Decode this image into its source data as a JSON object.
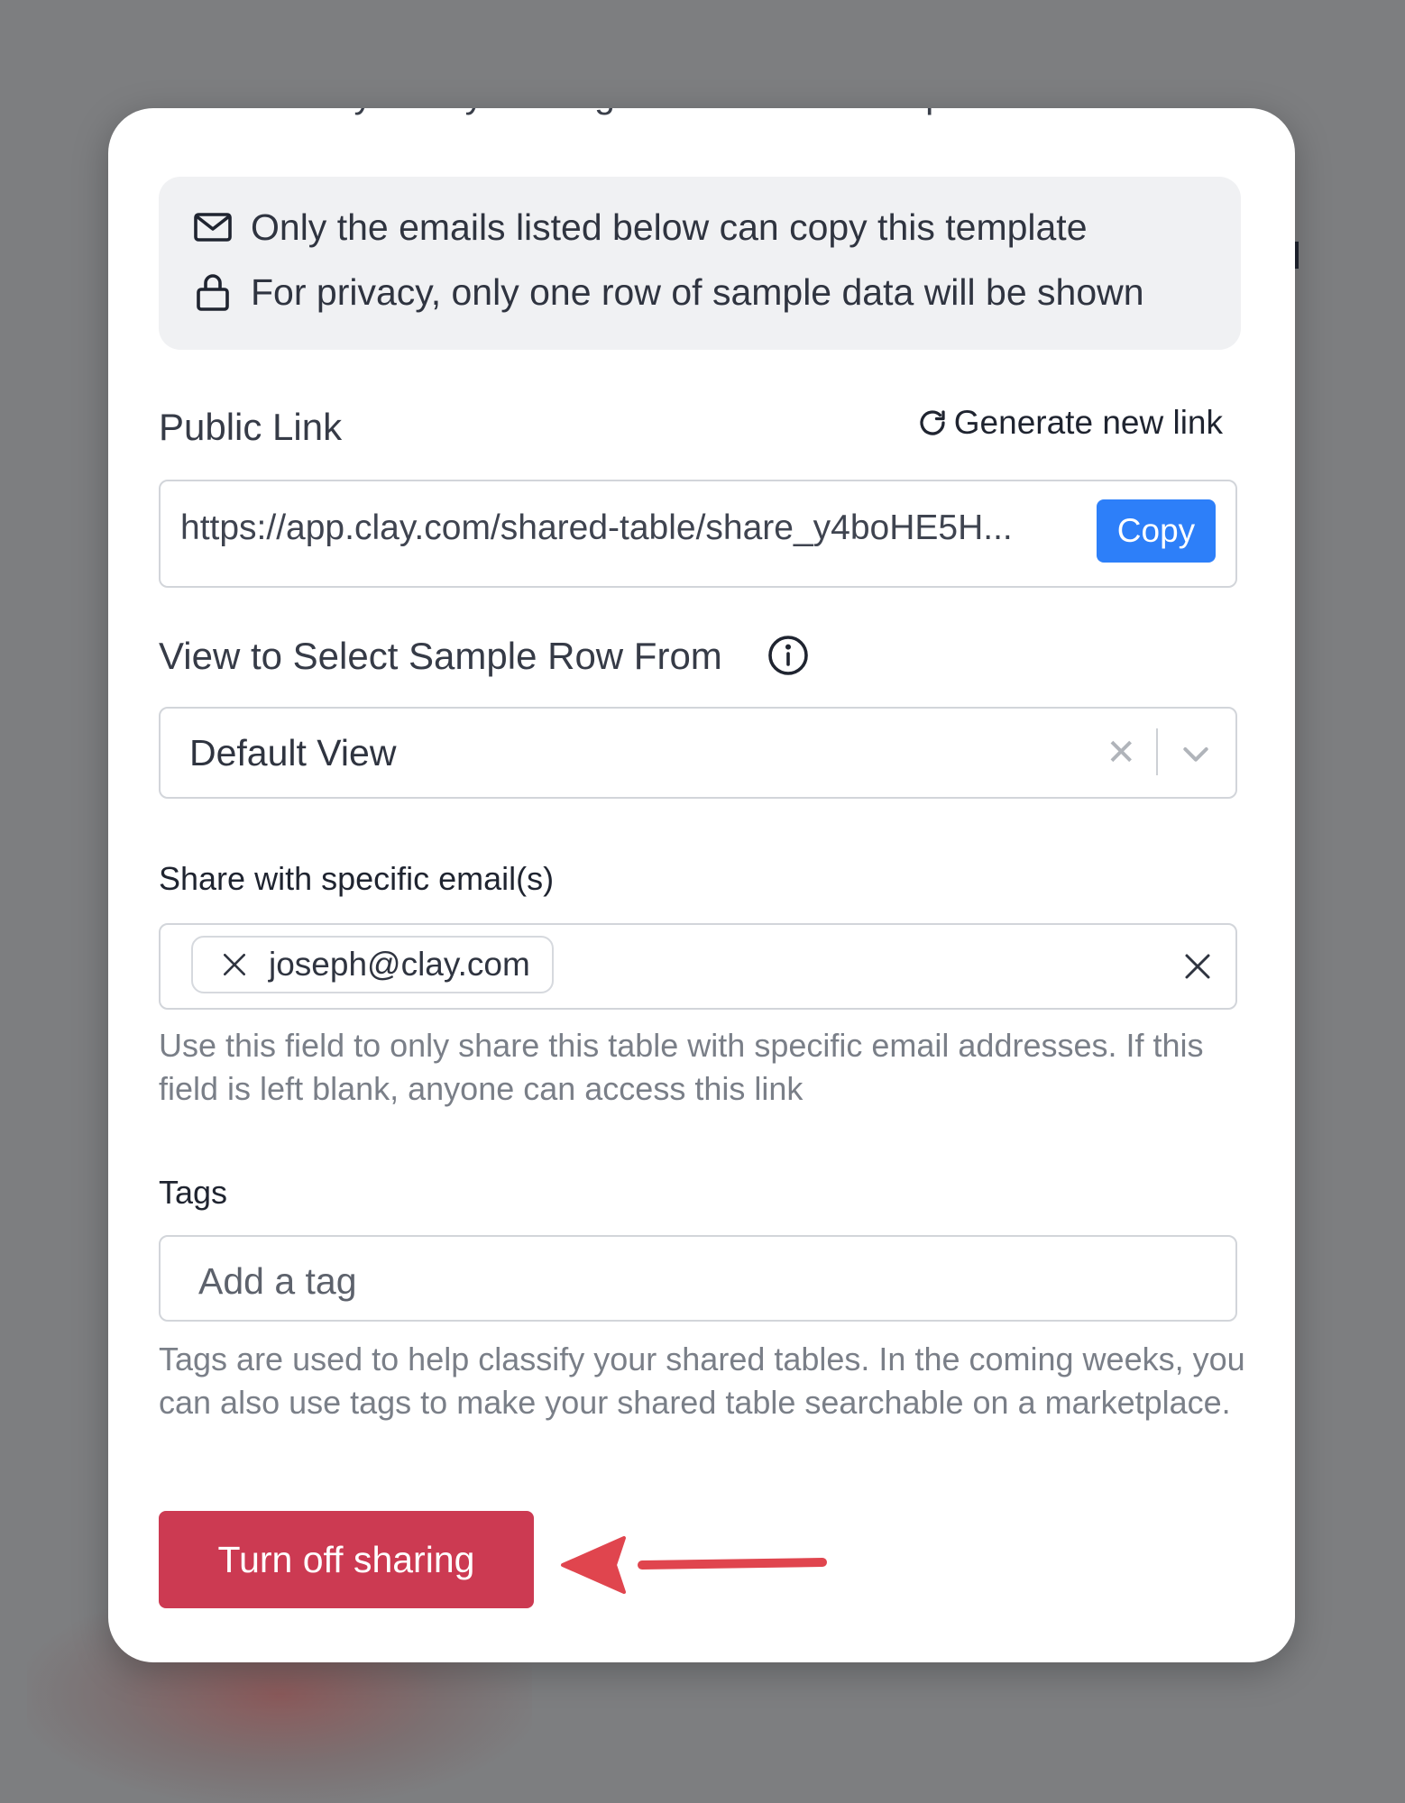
{
  "dialog": {
    "intro_cut": "visible to anyone by sharing this table as a template.",
    "notice": {
      "line1": "Only the emails listed below can copy this template",
      "line2": "For privacy, only one row of sample data will be shown"
    },
    "public_link": {
      "label": "Public Link",
      "generate_label": "Generate new link",
      "url": "https://app.clay.com/shared-table/share_y4boHE5H...",
      "copy_label": "Copy"
    },
    "view_select": {
      "label": "View to Select Sample Row From",
      "value": "Default View"
    },
    "emails": {
      "label": "Share with specific email(s)",
      "chips": [
        "joseph@clay.com"
      ],
      "help": "Use this field to only share this table with specific email addresses. If this field is left blank, anyone can access this link"
    },
    "tags": {
      "label": "Tags",
      "placeholder": "Add a tag",
      "help": "Tags are used to help classify your shared tables. In the coming weeks, you can also use tags to make your shared table searchable on a marketplace."
    },
    "turn_off_label": "Turn off sharing"
  },
  "colors": {
    "primary": "#2d7ff9",
    "danger": "#cc3a52",
    "annotation_arrow": "#e0454e"
  }
}
